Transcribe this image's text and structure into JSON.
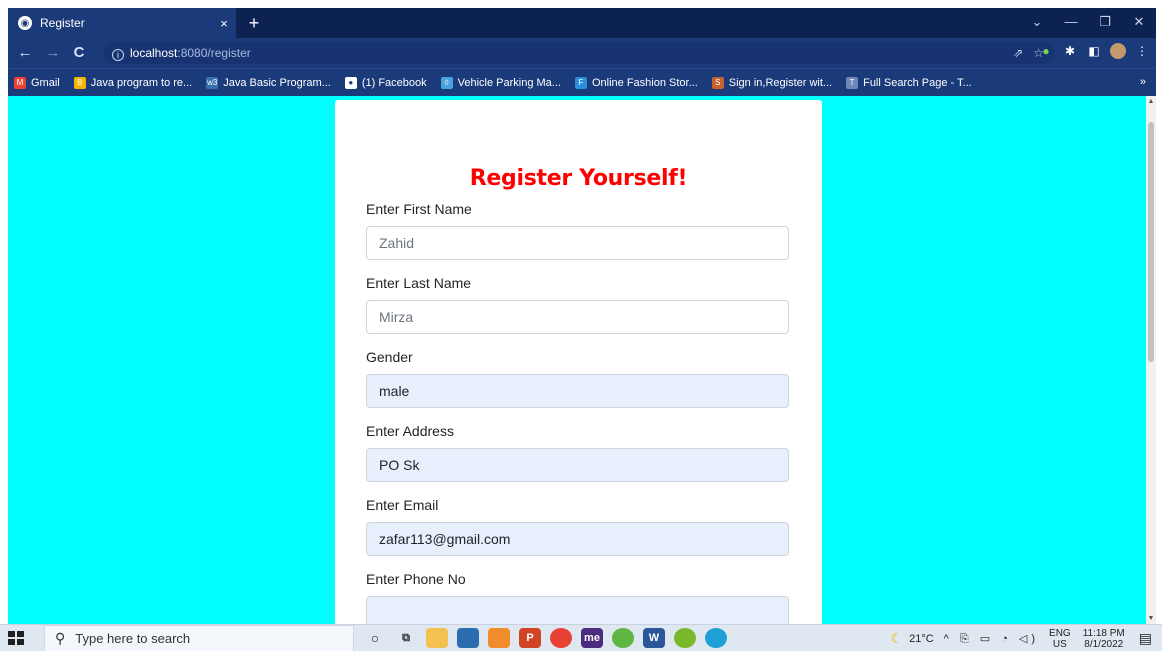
{
  "browser": {
    "tab_title": "Register",
    "tab_close": "×",
    "new_tab": "+",
    "url_host": "localhost",
    "url_rest": ":8080/register",
    "bookmarks": [
      {
        "label": "Gmail",
        "color": "#ea4335",
        "icon": "M"
      },
      {
        "label": "Java program to re...",
        "color": "#f4b400",
        "icon": "B"
      },
      {
        "label": "Java Basic Program...",
        "color": "#3a6fb0",
        "icon": "w3"
      },
      {
        "label": "(1) Facebook",
        "color": "#ffffff",
        "icon": "●"
      },
      {
        "label": "Vehicle Parking Ma...",
        "color": "#4aa3df",
        "icon": "◊"
      },
      {
        "label": "Online Fashion Stor...",
        "color": "#2a8fd8",
        "icon": "F"
      },
      {
        "label": "Sign in,Register wit...",
        "color": "#c6622b",
        "icon": "S"
      },
      {
        "label": "Full Search Page - T...",
        "color": "#6f86b8",
        "icon": "T"
      }
    ],
    "bookmarks_more": "»"
  },
  "page": {
    "heading": "Register Yourself!",
    "first_name_label": "Enter First Name",
    "first_name_placeholder": "Zahid",
    "last_name_label": "Enter Last Name",
    "last_name_placeholder": "Mirza",
    "gender_label": "Gender",
    "gender_value": "male",
    "address_label": "Enter Address",
    "address_value": "PO Sk",
    "email_label": "Enter Email",
    "email_value": "zafar113@gmail.com",
    "phone_label": "Enter Phone No"
  },
  "taskbar": {
    "search_placeholder": "Type here to search",
    "temperature": "21°C",
    "lang_line1": "ENG",
    "lang_line2": "US",
    "time": "11:18 PM",
    "date": "8/1/2022"
  },
  "colors": {
    "page_background": "#00ffff",
    "heading": "#ff0000",
    "autofill_field": "#e8f0fe"
  }
}
